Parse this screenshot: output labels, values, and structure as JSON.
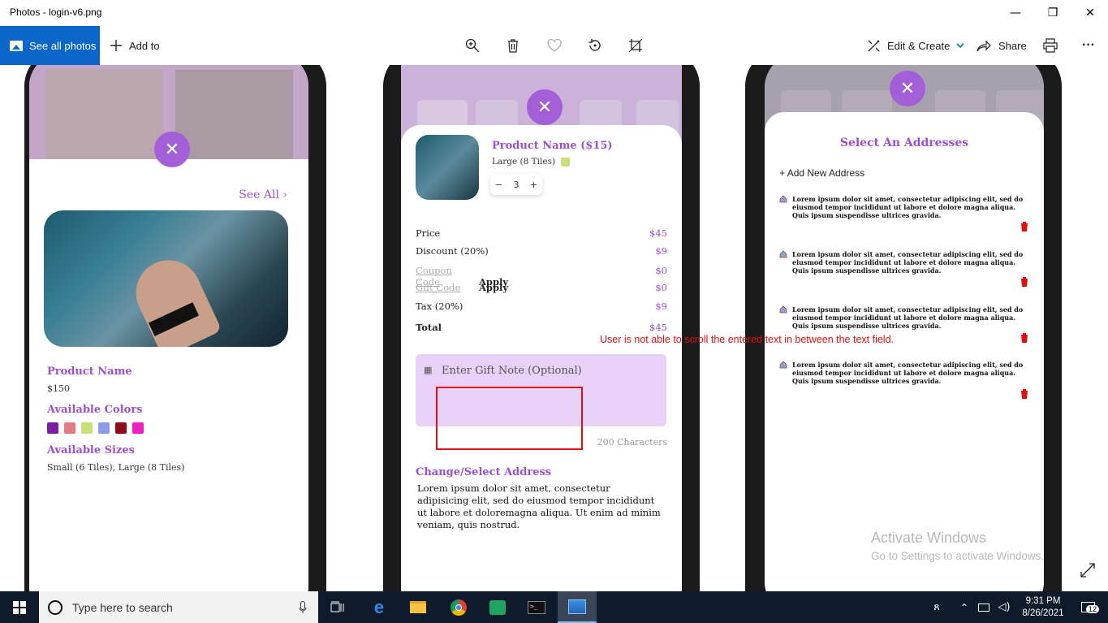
{
  "window": {
    "title": "Photos - login-v6.png",
    "controls": {
      "minimize": "—",
      "restore": "❐",
      "close": "✕"
    }
  },
  "toolbar": {
    "see_all": "See all photos",
    "add_to": "Add to",
    "edit_create": "Edit & Create",
    "share": "Share",
    "more": "···"
  },
  "phone1": {
    "see_all": "See All",
    "product_name": "Product Name",
    "price": "$150",
    "colors_label": "Available Colors",
    "colors": [
      "#7a1fa2",
      "#e57a86",
      "#c7e07a",
      "#8a9be8",
      "#8f0a14",
      "#f01ec0"
    ],
    "sizes_label": "Available Sizes",
    "sizes": "Small (6 Tiles), Large (8 Tiles)"
  },
  "phone2": {
    "product_title": "Product Name ($15)",
    "size": "Large (8 Tiles)",
    "quantity": "3",
    "price_label": "Price",
    "price_val": "$45",
    "discount_label": "Discount (20%)",
    "discount_val": "$9",
    "coupon_label": "Coupon Code",
    "coupon_apply": "Apply",
    "coupon_val": "$0",
    "gift_label": "Gift Code",
    "gift_apply": "Apply",
    "gift_val": "$0",
    "tax_label": "Tax (20%)",
    "tax_val": "$9",
    "total_label": "Total",
    "total_val": "$45",
    "gift_note_placeholder": "Enter Gift Note (Optional)",
    "char_count": "200 Characters",
    "change_address": "Change/Select Address",
    "address_text": "Lorem ipsum dolor sit amet, consectetur adipisicing elit, sed do eiusmod tempor incididunt ut labore et doloremagna aliqua. Ut enim ad minim veniam, quis nostrud."
  },
  "annotation": "User is not able to scroll the entered text in between the text field.",
  "phone3": {
    "title": "Select An Addresses",
    "add_new": "Add New Address",
    "addresses": [
      "Lorem ipsum dolor sit amet, consectetur adipiscing elit, sed do eiusmod tempor incididunt ut labore et dolore magna aliqua. Quis ipsum suspendisse ultrices gravida.",
      "Lorem ipsum dolor sit amet, consectetur adipiscing elit, sed do eiusmod tempor incididunt ut labore et dolore magna aliqua. Quis ipsum suspendisse ultrices gravida.",
      "Lorem ipsum dolor sit amet, consectetur adipiscing elit, sed do eiusmod tempor incididunt ut labore et dolore magna aliqua. Quis ipsum suspendisse ultrices gravida.",
      "Lorem ipsum dolor sit amet, consectetur adipiscing elit, sed do eiusmod tempor incididunt ut labore et dolore magna aliqua. Quis ipsum suspendisse ultrices gravida."
    ]
  },
  "watermark": {
    "line1": "Activate Windows",
    "line2": "Go to Settings to activate Windows."
  },
  "taskbar": {
    "search_placeholder": "Type here to search",
    "time": "9:31 PM",
    "date": "8/26/2021",
    "notification_count": "12"
  },
  "colors": {
    "accent": "#0a66c8",
    "purple": "#9b4fd6",
    "annotation_red": "#e01010",
    "taskbar": "#0f1b2b"
  }
}
